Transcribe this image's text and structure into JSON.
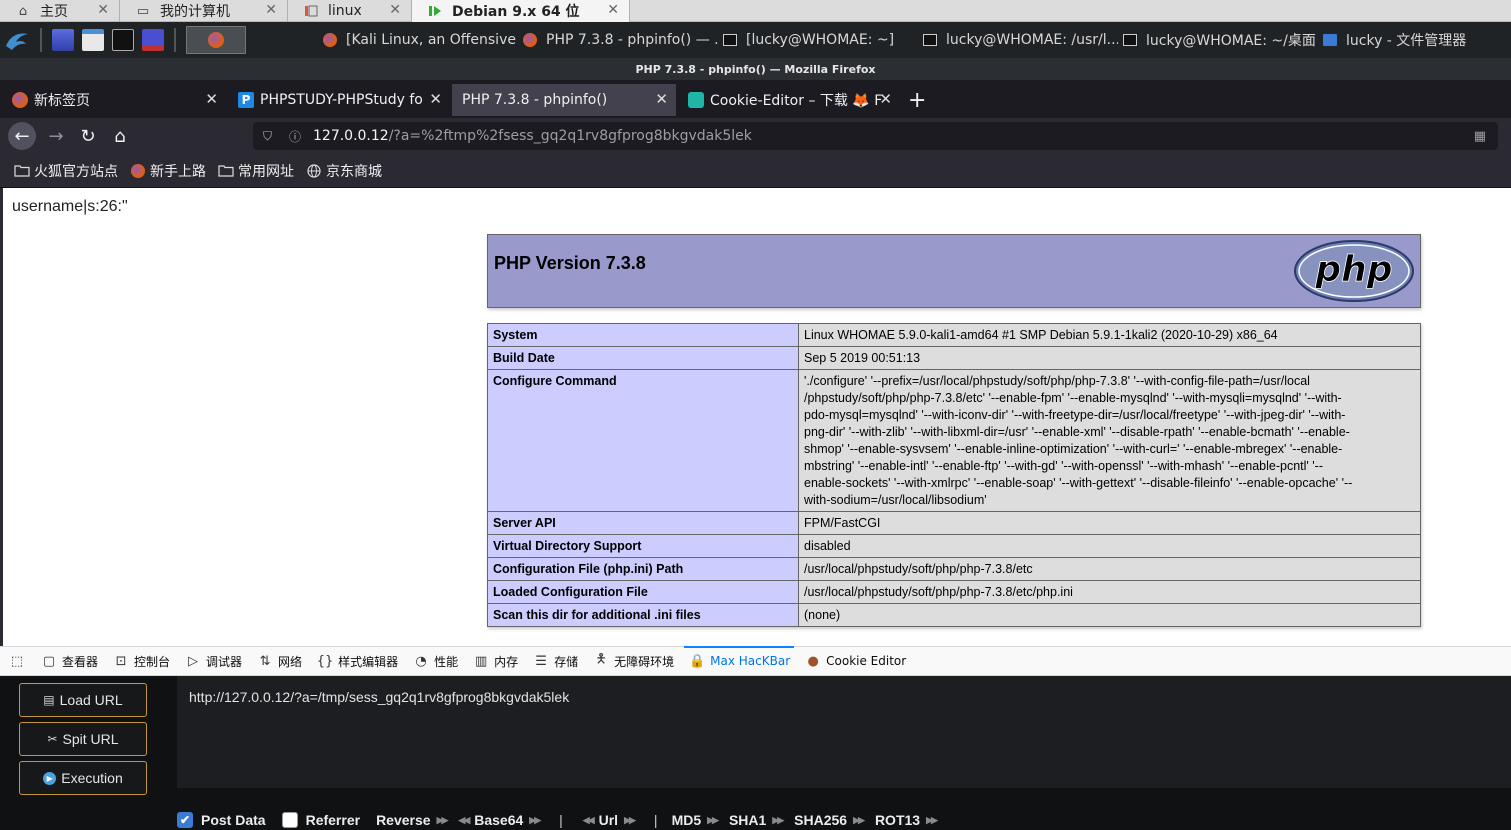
{
  "vm_tabs": [
    {
      "label": "主页",
      "icon": "home-icon"
    },
    {
      "label": "我的计算机",
      "icon": "computer-icon"
    },
    {
      "label": "linux",
      "icon": "vm-icon"
    },
    {
      "label": "Debian 9.x 64 位",
      "icon": "vm-running-icon",
      "active": true
    }
  ],
  "taskbar": {
    "windows": [
      {
        "label": "[Kali Linux, an Offensive ...",
        "icon": "firefox-icon"
      },
      {
        "label": "PHP 7.3.8 - phpinfo() — ...",
        "icon": "firefox-icon"
      },
      {
        "label": "[lucky@WHOMAE: ~]",
        "icon": "terminal-icon"
      },
      {
        "label": "lucky@WHOMAE: /usr/l...",
        "icon": "terminal-icon"
      },
      {
        "label": "lucky@WHOMAE: ~/桌面",
        "icon": "terminal-icon"
      },
      {
        "label": "lucky - 文件管理器",
        "icon": "folder-icon"
      }
    ]
  },
  "window_title": "PHP 7.3.8 - phpinfo() — Mozilla Firefox",
  "browser_tabs": [
    {
      "label": "新标签页"
    },
    {
      "label": "PHPSTUDY-PHPStudy fo",
      "favicon_letter": "P"
    },
    {
      "label": "PHP 7.3.8 - phpinfo()",
      "selected": true
    },
    {
      "label": "Cookie-Editor – 下载 🦊 F"
    }
  ],
  "url": {
    "host": "127.0.0.12",
    "path": "/?a=%2ftmp%2fsess_gq2q1rv8gfprog8bkgvdak5lek"
  },
  "bookmarks": [
    {
      "label": "火狐官方站点",
      "icon": "folder-icon"
    },
    {
      "label": "新手上路",
      "icon": "firefox-icon"
    },
    {
      "label": "常用网址",
      "icon": "folder-icon"
    },
    {
      "label": "京东商城",
      "icon": "globe-icon"
    }
  ],
  "page": {
    "session_text": "username|s:26:\"",
    "php_version_title": "PHP Version 7.3.8",
    "php_logo_text": "php",
    "rows": [
      {
        "key": "System",
        "value": "Linux WHOMAE 5.9.0-kali1-amd64 #1 SMP Debian 5.9.1-1kali2 (2020-10-29) x86_64"
      },
      {
        "key": "Build Date",
        "value": "Sep 5 2019 00:51:13"
      },
      {
        "key": "Configure Command",
        "lines": [
          "'./configure' '--prefix=/usr/local/phpstudy/soft/php/php-7.3.8' '--with-config-file-path=/usr/local",
          "/phpstudy/soft/php/php-7.3.8/etc' '--enable-fpm' '--enable-mysqlnd' '--with-mysqli=mysqlnd' '--with-",
          "pdo-mysql=mysqlnd' '--with-iconv-dir' '--with-freetype-dir=/usr/local/freetype' '--with-jpeg-dir' '--with-",
          "png-dir' '--with-zlib' '--with-libxml-dir=/usr' '--enable-xml' '--disable-rpath' '--enable-bcmath' '--enable-",
          "shmop' '--enable-sysvsem' '--enable-inline-optimization' '--with-curl=' '--enable-mbregex' '--enable-",
          "mbstring' '--enable-intl' '--enable-ftp' '--with-gd' '--with-openssl' '--with-mhash' '--enable-pcntl' '--",
          "enable-sockets' '--with-xmlrpc' '--enable-soap' '--with-gettext' '--disable-fileinfo' '--enable-opcache' '--",
          "with-sodium=/usr/local/libsodium'"
        ]
      },
      {
        "key": "Server API",
        "value": "FPM/FastCGI"
      },
      {
        "key": "Virtual Directory Support",
        "value": "disabled"
      },
      {
        "key": "Configuration File (php.ini) Path",
        "value": "/usr/local/phpstudy/soft/php/php-7.3.8/etc"
      },
      {
        "key": "Loaded Configuration File",
        "value": "/usr/local/phpstudy/soft/php/php-7.3.8/etc/php.ini"
      },
      {
        "key": "Scan this dir for additional .ini files",
        "value": "(none)"
      }
    ]
  },
  "devtools": {
    "tabs": [
      {
        "label": "查看器",
        "icon": "inspector-icon"
      },
      {
        "label": "控制台",
        "icon": "console-icon"
      },
      {
        "label": "调试器",
        "icon": "debugger-icon"
      },
      {
        "label": "网络",
        "icon": "network-icon"
      },
      {
        "label": "样式编辑器",
        "icon": "style-editor-icon"
      },
      {
        "label": "性能",
        "icon": "performance-icon"
      },
      {
        "label": "内存",
        "icon": "memory-icon"
      },
      {
        "label": "存储",
        "icon": "storage-icon"
      },
      {
        "label": "无障碍环境",
        "icon": "accessibility-icon"
      },
      {
        "label": "Max HacKBar",
        "icon": "hackbar-icon",
        "active": true
      },
      {
        "label": "Cookie Editor",
        "icon": "cookie-icon"
      }
    ]
  },
  "hackbar": {
    "buttons": {
      "load": "Load URL",
      "split": "Spit URL",
      "execute": "Execution"
    },
    "url_value": "http://127.0.0.12/?a=/tmp/sess_gq2q1rv8gfprog8bkgvdak5lek",
    "options": {
      "post_data": {
        "label": "Post Data",
        "checked": true
      },
      "referrer": {
        "label": "Referrer",
        "checked": false
      },
      "reverse": "Reverse",
      "base64": "Base64",
      "url": "Url",
      "md5": "MD5",
      "sha1": "SHA1",
      "sha256": "SHA256",
      "rot13": "ROT13"
    }
  },
  "colors": {
    "php_header_bg": "#9999cc",
    "php_key_bg": "#ccccff",
    "php_value_bg": "#dddddd",
    "hackbar_border": "#c6973a",
    "firefox_dark": "#2b2a33"
  }
}
